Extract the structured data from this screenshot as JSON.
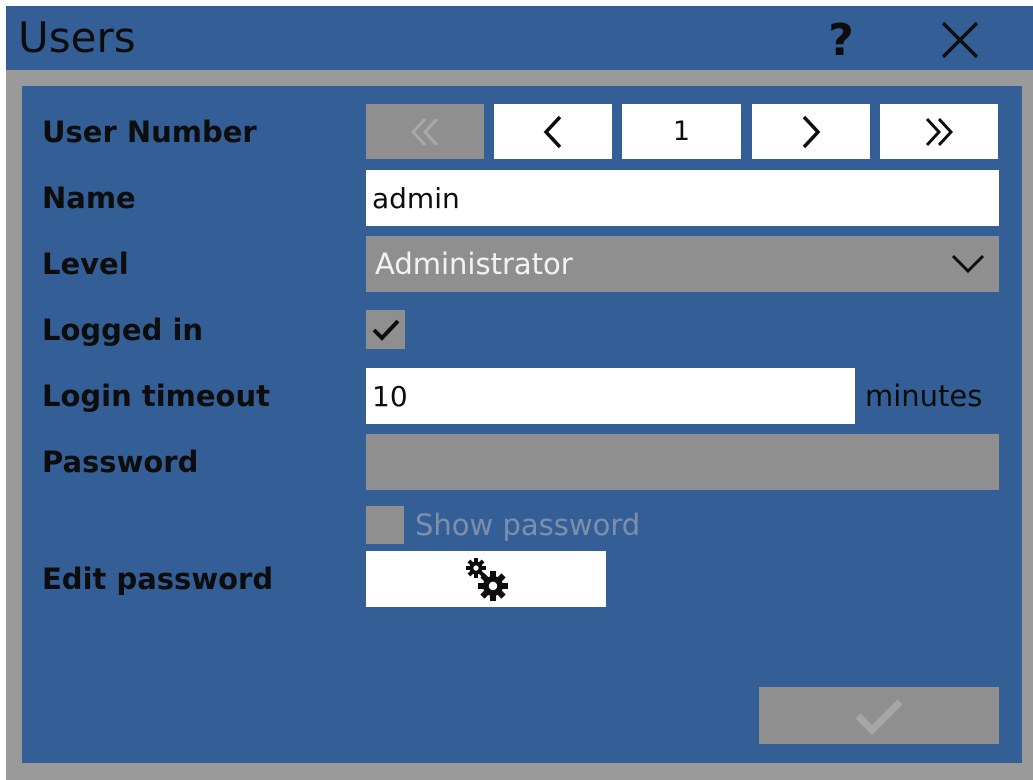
{
  "window": {
    "title": "Users"
  },
  "titlebar": {
    "help_glyph": "?",
    "help_icon": "question-mark-icon",
    "close_icon": "close-icon"
  },
  "form": {
    "user_number": {
      "label": "User Number",
      "value": "1",
      "first_icon": "double-chevron-left-icon",
      "prev_icon": "chevron-left-icon",
      "next_icon": "chevron-right-icon",
      "last_icon": "double-chevron-right-icon",
      "first_enabled": false
    },
    "name": {
      "label": "Name",
      "value": "admin"
    },
    "level": {
      "label": "Level",
      "value": "Administrator",
      "icon": "chevron-down-icon"
    },
    "logged_in": {
      "label": "Logged in",
      "checked": true
    },
    "login_timeout": {
      "label": "Login timeout",
      "value": "10",
      "unit": "minutes"
    },
    "password": {
      "label": "Password",
      "value": "",
      "enabled": false
    },
    "show_password": {
      "label": "Show password",
      "checked": false,
      "enabled": false
    },
    "edit_password": {
      "label": "Edit password",
      "icon": "gears-icon"
    }
  },
  "footer": {
    "confirm_icon": "checkmark-icon",
    "confirm_enabled": false
  },
  "colors": {
    "panel": "#345e96",
    "frame": "#9a9a9a",
    "disabled": "#8f8f8f",
    "field": "#ffffff",
    "text": "#0d0d0d",
    "disabled_text": "#7c8fab"
  }
}
